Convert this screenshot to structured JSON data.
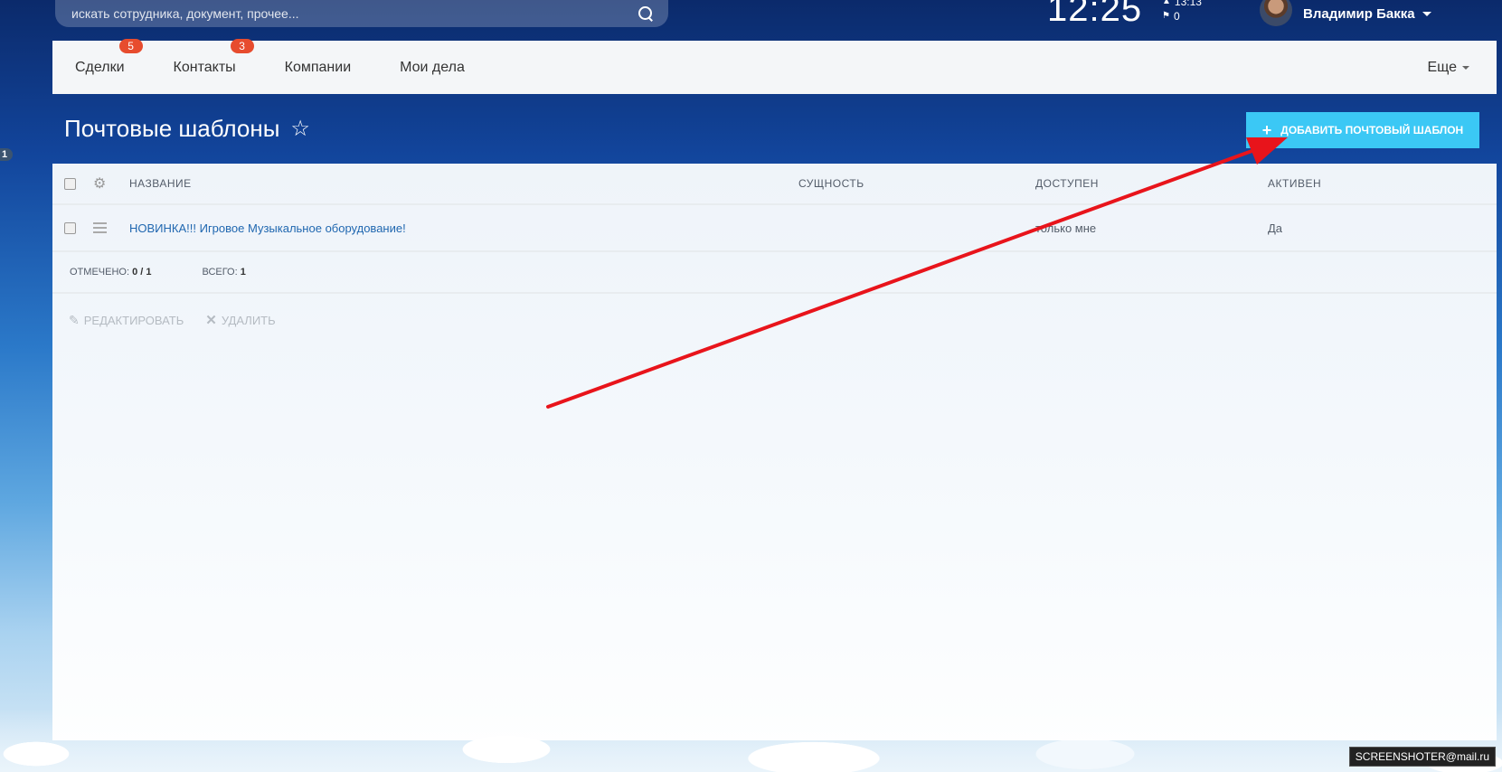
{
  "topbar": {
    "search_placeholder": "искать сотрудника, документ, прочее...",
    "clock": "12:25",
    "counter_top": "13:13",
    "counter_bottom": "0",
    "user_name": "Владимир Бакка"
  },
  "left_badge": "1",
  "nav": {
    "items": [
      {
        "label": "Сделки",
        "badge": "5"
      },
      {
        "label": "Контакты",
        "badge": "3"
      },
      {
        "label": "Компании"
      },
      {
        "label": "Мои дела"
      }
    ],
    "more": "Еще"
  },
  "page": {
    "title": "Почтовые шаблоны",
    "add_button": "ДОБАВИТЬ ПОЧТОВЫЙ ШАБЛОН"
  },
  "grid": {
    "columns": {
      "name": "НАЗВАНИЕ",
      "entity": "СУЩНОСТЬ",
      "access": "ДОСТУПЕН",
      "active": "АКТИВЕН"
    },
    "rows": [
      {
        "name": "НОВИНКА!!! Игровое Музыкальное оборудование!",
        "entity": "",
        "access": "только мне",
        "active": "Да"
      }
    ],
    "footer": {
      "selected_label": "ОТМЕЧЕНО:",
      "selected_value": "0 / 1",
      "total_label": "ВСЕГО:",
      "total_value": "1"
    },
    "actions": {
      "edit": "РЕДАКТИРОВАТЬ",
      "delete": "УДАЛИТЬ"
    }
  },
  "watermark": "SCREENSHOTER@mail.ru",
  "colors": {
    "accent_button": "#3bc8f5",
    "badge": "#e74c2e",
    "link": "#2067b0",
    "annotation_arrow": "#e8141b"
  }
}
